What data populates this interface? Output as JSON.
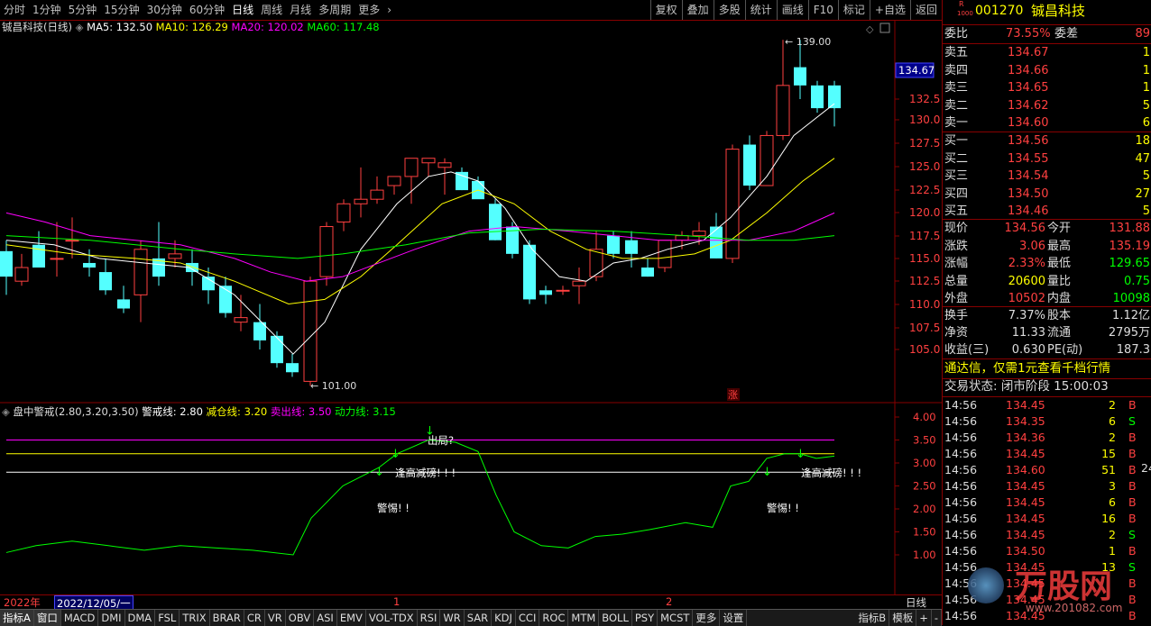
{
  "periods": [
    "分时",
    "1分钟",
    "5分钟",
    "15分钟",
    "30分钟",
    "60分钟",
    "日线",
    "周线",
    "月线",
    "多周期",
    "更多"
  ],
  "active_period": "日线",
  "more_icon": "chevron-right-icon",
  "toolbar_right": [
    "复权",
    "叠加",
    "多股",
    "统计",
    "画线",
    "F10",
    "标记",
    "+自选",
    "返回"
  ],
  "chart": {
    "title": "铖昌科技(日线)",
    "ma": [
      {
        "label": "MA5: 132.50",
        "color": "#ffffff"
      },
      {
        "label": "MA10: 126.29",
        "color": "#ffff00"
      },
      {
        "label": "MA20: 120.02",
        "color": "#ff00ff"
      },
      {
        "label": "MA60: 117.48",
        "color": "#00ff00"
      }
    ],
    "high_label": "139.00",
    "low_label": "101.00",
    "current_price": "134.67",
    "zhang_label": "涨",
    "y_ticks": [
      "132.5",
      "130.0",
      "127.5",
      "125.0",
      "122.5",
      "120.0",
      "117.5",
      "115.0",
      "112.5",
      "110.0",
      "107.5",
      "105.0"
    ],
    "ind_ticks": [
      "4.00",
      "3.50",
      "3.00",
      "2.50",
      "2.00",
      "1.50",
      "1.00"
    ]
  },
  "indicator": {
    "title": "盘中警戒(2.80,3.20,3.50)",
    "items": [
      {
        "label": "警戒线: 2.80",
        "color": "#ffffff"
      },
      {
        "label": "减仓线: 3.20",
        "color": "#ffff00"
      },
      {
        "label": "卖出线: 3.50",
        "color": "#ff00ff"
      },
      {
        "label": "动力线: 3.15",
        "color": "#00ff00"
      }
    ],
    "annotations": [
      "出局?",
      "逢高减磅! ! !",
      "警惕! !",
      "逢高减磅! ! !",
      "警惕! !"
    ]
  },
  "axis_bottom": {
    "year": "2022年",
    "date": "2022/12/05/一",
    "m1": "1",
    "m2": "2",
    "period": "日线"
  },
  "tabs": [
    "指标A",
    "窗口",
    "MACD",
    "DMI",
    "DMA",
    "FSL",
    "TRIX",
    "BRAR",
    "CR",
    "VR",
    "OBV",
    "ASI",
    "EMV",
    "VOL-TDX",
    "RSI",
    "WR",
    "SAR",
    "KDJ",
    "CCI",
    "ROC",
    "MTM",
    "BOLL",
    "PSY",
    "MCST",
    "更多",
    "设置"
  ],
  "tabs_right": [
    "指标B",
    "模板",
    "+",
    "-"
  ],
  "stock": {
    "code": "001270",
    "name": "铖昌科技",
    "badge_top": "R",
    "badge_bottom": "1000"
  },
  "weibi": {
    "label": "委比",
    "value": "73.55%",
    "label2": "委差",
    "value2": "89"
  },
  "sells": [
    {
      "label": "卖五",
      "price": "134.67",
      "vol": "1"
    },
    {
      "label": "卖四",
      "price": "134.66",
      "vol": "1"
    },
    {
      "label": "卖三",
      "price": "134.65",
      "vol": "1"
    },
    {
      "label": "卖二",
      "price": "134.62",
      "vol": "5"
    },
    {
      "label": "卖一",
      "price": "134.60",
      "vol": "6"
    }
  ],
  "buys": [
    {
      "label": "买一",
      "price": "134.56",
      "vol": "18"
    },
    {
      "label": "买二",
      "price": "134.55",
      "vol": "47"
    },
    {
      "label": "买三",
      "price": "134.54",
      "vol": "5"
    },
    {
      "label": "买四",
      "price": "134.50",
      "vol": "27"
    },
    {
      "label": "买五",
      "price": "134.46",
      "vol": "5"
    }
  ],
  "quote": [
    {
      "l1": "现价",
      "v1": "134.56",
      "c1": "#ff4040",
      "l2": "今开",
      "v2": "131.88",
      "c2": "#ff4040"
    },
    {
      "l1": "涨跌",
      "v1": "3.06",
      "c1": "#ff4040",
      "l2": "最高",
      "v2": "135.19",
      "c2": "#ff4040"
    },
    {
      "l1": "涨幅",
      "v1": "2.33%",
      "c1": "#ff4040",
      "l2": "最低",
      "v2": "129.65",
      "c2": "#00ff00"
    },
    {
      "l1": "总量",
      "v1": "20600",
      "c1": "#ffff00",
      "l2": "量比",
      "v2": "0.75",
      "c2": "#00ff00"
    },
    {
      "l1": "外盘",
      "v1": "10502",
      "c1": "#ff4040",
      "l2": "内盘",
      "v2": "10098",
      "c2": "#00ff00"
    }
  ],
  "finance": [
    {
      "l1": "换手",
      "v1": "7.37%",
      "l2": "股本",
      "v2": "1.12亿"
    },
    {
      "l1": "净资",
      "v1": "11.33",
      "l2": "流通",
      "v2": "2795万"
    },
    {
      "l1": "收益(三)",
      "v1": "0.630",
      "l2": "PE(动)",
      "v2": "187.3"
    }
  ],
  "ad_text": "通达信，仅需1元查看千档行情",
  "status": "交易状态: 闭市阶段 15:00:03",
  "ticks": [
    {
      "t": "14:56",
      "p": "134.45",
      "v": "2",
      "s": "B"
    },
    {
      "t": "14:56",
      "p": "134.35",
      "v": "6",
      "s": "S"
    },
    {
      "t": "14:56",
      "p": "134.36",
      "v": "2",
      "s": "B"
    },
    {
      "t": "14:56",
      "p": "134.45",
      "v": "15",
      "s": "B"
    },
    {
      "t": "14:56",
      "p": "134.60",
      "v": "51",
      "s": "B"
    },
    {
      "t": "14:56",
      "p": "134.45",
      "v": "3",
      "s": "B"
    },
    {
      "t": "14:56",
      "p": "134.45",
      "v": "6",
      "s": "B"
    },
    {
      "t": "14:56",
      "p": "134.45",
      "v": "16",
      "s": "B"
    },
    {
      "t": "14:56",
      "p": "134.45",
      "v": "2",
      "s": "S"
    },
    {
      "t": "14:56",
      "p": "134.50",
      "v": "1",
      "s": "B"
    },
    {
      "t": "14:56",
      "p": "134.45",
      "v": "13",
      "s": "S"
    },
    {
      "t": "14:56",
      "p": "134.45",
      "v": "",
      "s": "B"
    },
    {
      "t": "14:56",
      "p": "134.45",
      "v": "",
      "s": "B"
    },
    {
      "t": "14:56",
      "p": "134.45",
      "v": "",
      "s": "B"
    }
  ],
  "tick_extra": "24",
  "watermark": "万股网",
  "watermark_url": "www.201082.com"
}
